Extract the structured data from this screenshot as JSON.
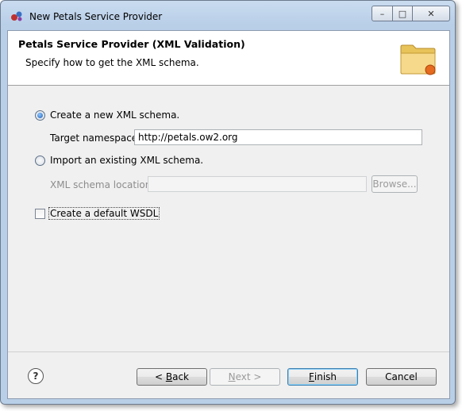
{
  "window": {
    "title": "New Petals Service Provider",
    "controls": {
      "minimize": "–",
      "maximize": "□",
      "close": "✕"
    }
  },
  "header": {
    "title": "Petals Service Provider (XML Validation)",
    "description": "Specify how to get the XML schema."
  },
  "form": {
    "create_option": {
      "label": "Create a new XML schema.",
      "selected": true
    },
    "target_namespace": {
      "label": "Target namespace:",
      "value": "http://petals.ow2.org"
    },
    "import_option": {
      "label": "Import an existing XML schema.",
      "selected": false
    },
    "schema_location": {
      "label": "XML schema location:",
      "value": "",
      "enabled": false
    },
    "browse_label": "Browse...",
    "default_wsdl": {
      "label": "Create a default WSDL",
      "checked": false
    }
  },
  "buttons": {
    "help": "?",
    "back_prefix": "< ",
    "back_mnemonic": "B",
    "back_rest": "ack",
    "next_mnemonic": "N",
    "next_rest": "ext >",
    "finish_mnemonic": "F",
    "finish_rest": "inish",
    "cancel": "Cancel"
  },
  "icons": {
    "app": "petals-app-icon",
    "banner": "folder-wizard-icon",
    "help": "help-icon"
  }
}
